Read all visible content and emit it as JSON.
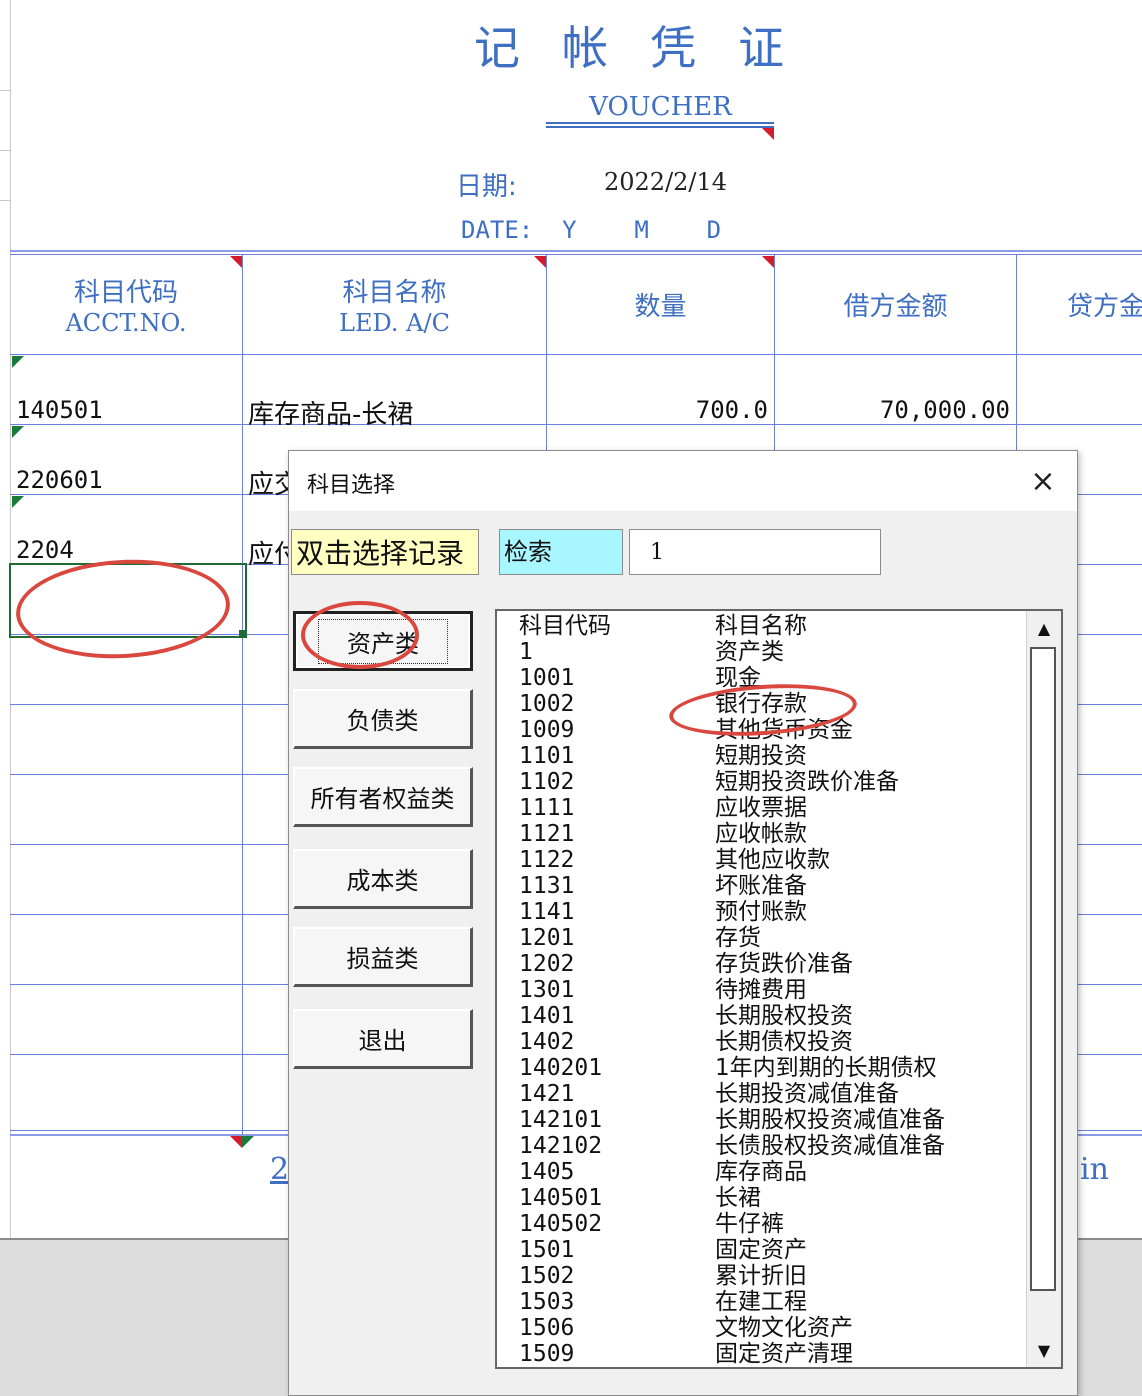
{
  "voucher": {
    "title_cn": "记帐凭证",
    "title_en": "VOUCHER",
    "date_label": "日期:",
    "date_value": "2022/2/14",
    "date_en": "DATE:  Y    M    D"
  },
  "table": {
    "headers": [
      {
        "cn": "科目代码",
        "en": "ACCT.NO."
      },
      {
        "cn": "科目名称",
        "en": "LED. A/C"
      },
      {
        "cn": "数量",
        "en": ""
      },
      {
        "cn": "借方金额",
        "en": ""
      },
      {
        "cn": "贷方金",
        "en": ""
      }
    ],
    "rows": [
      {
        "code": "140501",
        "name": "库存商品-长裙",
        "qty": "700.0",
        "debit": "70,000.00"
      },
      {
        "code": "220601",
        "name": "应交"
      },
      {
        "code": "2204",
        "name": "应付"
      }
    ],
    "footer_left": "2",
    "footer_right": "in"
  },
  "dialog": {
    "title": "科目选择",
    "close_icon": "×",
    "hint": "双击选择记录",
    "search_label": "检索",
    "search_value": "1",
    "categories": [
      "资产类",
      "负债类",
      "所有者权益类",
      "成本类",
      "损益类",
      "退出"
    ],
    "active_category": "资产类",
    "list_header": {
      "code": "科目代码",
      "name": "科目名称"
    },
    "accounts": [
      {
        "code": "1",
        "name": "资产类"
      },
      {
        "code": "1001",
        "name": "现金"
      },
      {
        "code": "1002",
        "name": "银行存款"
      },
      {
        "code": "1009",
        "name": "其他货币资金"
      },
      {
        "code": "1101",
        "name": "短期投资"
      },
      {
        "code": "1102",
        "name": "短期投资跌价准备"
      },
      {
        "code": "1111",
        "name": "应收票据"
      },
      {
        "code": "1121",
        "name": "应收帐款"
      },
      {
        "code": "1122",
        "name": "其他应收款"
      },
      {
        "code": "1131",
        "name": "坏账准备"
      },
      {
        "code": "1141",
        "name": "预付账款"
      },
      {
        "code": "1201",
        "name": "存货"
      },
      {
        "code": "1202",
        "name": "存货跌价准备"
      },
      {
        "code": "1301",
        "name": "待摊费用"
      },
      {
        "code": "1401",
        "name": "长期股权投资"
      },
      {
        "code": "1402",
        "name": "长期债权投资"
      },
      {
        "code": "140201",
        "name": "1年内到期的长期债权"
      },
      {
        "code": "1421",
        "name": "长期投资减值准备"
      },
      {
        "code": "142101",
        "name": "长期股权投资减值准备"
      },
      {
        "code": "142102",
        "name": "长债股权投资减值准备"
      },
      {
        "code": "1405",
        "name": "库存商品"
      },
      {
        "code": "140501",
        "name": "长裙"
      },
      {
        "code": "140502",
        "name": "牛仔裤"
      },
      {
        "code": "1501",
        "name": "固定资产"
      },
      {
        "code": "1502",
        "name": "累计折旧"
      },
      {
        "code": "1503",
        "name": "在建工程"
      },
      {
        "code": "1506",
        "name": "文物文化资产"
      },
      {
        "code": "1509",
        "name": "固定资产清理"
      }
    ],
    "scroll_up_icon": "▲",
    "scroll_down_icon": "▼"
  },
  "colors": {
    "accent_blue": "#3e6fc2",
    "grid_blue": "#6b7fe0",
    "annotation_red": "#d9473e",
    "hint_yellow": "#ffffc2",
    "search_cyan": "#a8f6ff",
    "selection_green": "#1e6b35"
  }
}
